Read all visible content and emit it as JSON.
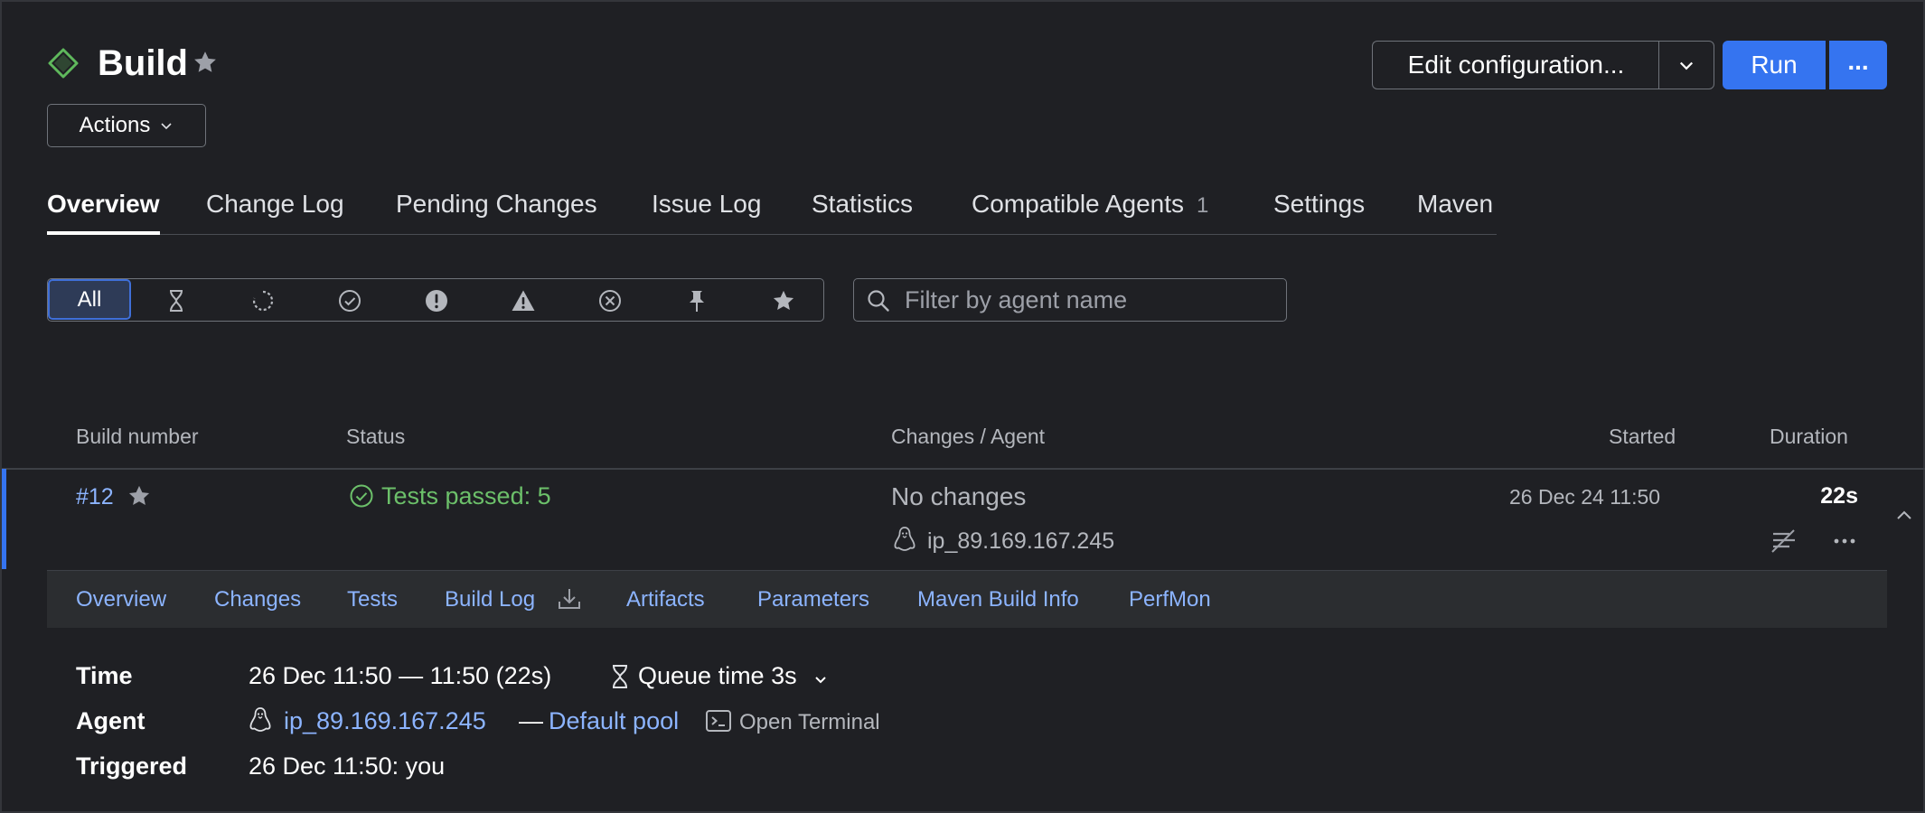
{
  "header": {
    "title": "Build",
    "actions_label": "Actions",
    "edit_config_label": "Edit configuration...",
    "run_label": "Run",
    "more_label": "..."
  },
  "tabs": [
    {
      "label": "Overview",
      "active": true
    },
    {
      "label": "Change Log"
    },
    {
      "label": "Pending Changes"
    },
    {
      "label": "Issue Log"
    },
    {
      "label": "Statistics"
    },
    {
      "label": "Compatible Agents",
      "count": "1"
    },
    {
      "label": "Settings"
    },
    {
      "label": "Maven"
    }
  ],
  "filter": {
    "all_label": "All",
    "icons": [
      "hourglass-icon",
      "running-icon",
      "success-icon",
      "error-icon",
      "warning-icon",
      "cancelled-icon",
      "pin-icon",
      "star-icon"
    ],
    "search_placeholder": "Filter by agent name"
  },
  "table": {
    "headers": {
      "build_number": "Build number",
      "status": "Status",
      "changes_agent": "Changes / Agent",
      "started": "Started",
      "duration": "Duration"
    },
    "row": {
      "build_number": "#12",
      "status": "Tests passed: 5",
      "changes": "No changes",
      "agent": "ip_89.169.167.245",
      "started": "26 Dec 24 11:50",
      "duration": "22s"
    }
  },
  "subtabs": [
    "Overview",
    "Changes",
    "Tests",
    "Build Log",
    "Artifacts",
    "Parameters",
    "Maven Build Info",
    "PerfMon"
  ],
  "details": {
    "time_label": "Time",
    "time_value": "26 Dec 11:50 — 11:50 (22s)",
    "queue_time": "Queue time 3s",
    "agent_label": "Agent",
    "agent_name": "ip_89.169.167.245",
    "agent_sep": "—",
    "agent_pool": "Default pool",
    "open_terminal": "Open Terminal",
    "triggered_label": "Triggered",
    "triggered_value": "26 Dec 11:50: you"
  },
  "colors": {
    "background": "#1f2024",
    "accent": "#3574f0",
    "link": "#8cb4ff",
    "success": "#6cc06a"
  }
}
